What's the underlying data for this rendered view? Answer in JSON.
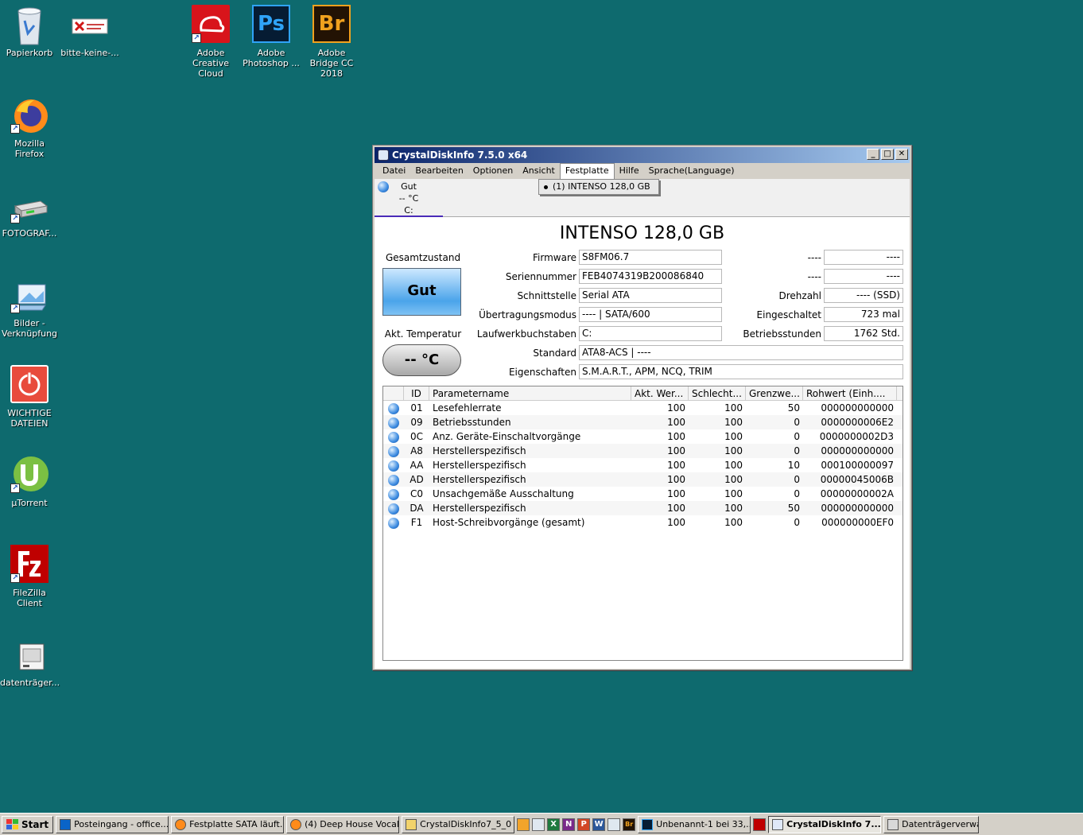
{
  "desktop": {
    "icons": [
      {
        "label": "Papierkorb"
      },
      {
        "label": "bitte-keine-..."
      },
      {
        "label": "Adobe Creative Cloud"
      },
      {
        "label": "Adobe Photoshop ..."
      },
      {
        "label": "Adobe Bridge CC 2018"
      },
      {
        "label": "Mozilla Firefox"
      },
      {
        "label": "FOTOGRAF..."
      },
      {
        "label": "Bilder - Verknüpfung"
      },
      {
        "label": "WICHTIGE DATEIEN"
      },
      {
        "label": "µTorrent"
      },
      {
        "label": "FileZilla Client"
      },
      {
        "label": "datenträger..."
      }
    ],
    "ps_glyph": "Ps",
    "br_glyph": "Br"
  },
  "window": {
    "title": "CrystalDiskInfo 7.5.0 x64",
    "controls": {
      "minimize": "_",
      "maximize": "□",
      "close": "✕"
    },
    "menu": [
      "Datei",
      "Bearbeiten",
      "Optionen",
      "Ansicht",
      "Festplatte",
      "Hilfe",
      "Sprache(Language)"
    ],
    "dropdown_item": "(1) INTENSO 128,0 GB",
    "drive_tab": {
      "status": "Gut",
      "temp": "-- °C",
      "letter": "C:"
    },
    "model": "INTENSO 128,0 GB",
    "health_label": "Gesamtzustand",
    "health_value": "Gut",
    "temp_label": "Akt. Temperatur",
    "temp_value": "-- °C",
    "fields": {
      "firmware": {
        "label": "Firmware",
        "value": "S8FM06.7"
      },
      "serial": {
        "label": "Seriennummer",
        "value": "FEB4074319B200086840"
      },
      "interface": {
        "label": "Schnittstelle",
        "value": "Serial ATA"
      },
      "transfer": {
        "label": "Übertragungsmodus",
        "value": "---- | SATA/600"
      },
      "letters": {
        "label": "Laufwerkbuchstaben",
        "value": "C:"
      },
      "standard": {
        "label": "Standard",
        "value": "ATA8-ACS | ----"
      },
      "features": {
        "label": "Eigenschaften",
        "value": "S.M.A.R.T., APM, NCQ, TRIM"
      },
      "r1": {
        "label": "----",
        "value": "----"
      },
      "r2": {
        "label": "----",
        "value": "----"
      },
      "rpm": {
        "label": "Drehzahl",
        "value": "---- (SSD)"
      },
      "powercount": {
        "label": "Eingeschaltet",
        "value": "723 mal"
      },
      "hours": {
        "label": "Betriebsstunden",
        "value": "1762 Std."
      }
    },
    "smart": {
      "headers": [
        "ID",
        "Parametername",
        "Akt. Wer...",
        "Schlecht...",
        "Grenzwe...",
        "Rohwert (Einh...."
      ],
      "rows": [
        [
          "01",
          "Lesefehlerrate",
          "100",
          "100",
          "50",
          "000000000000"
        ],
        [
          "09",
          "Betriebsstunden",
          "100",
          "100",
          "0",
          "0000000006E2"
        ],
        [
          "0C",
          "Anz. Geräte-Einschaltvorgänge",
          "100",
          "100",
          "0",
          "0000000002D3"
        ],
        [
          "A8",
          "Herstellerspezifisch",
          "100",
          "100",
          "0",
          "000000000000"
        ],
        [
          "AA",
          "Herstellerspezifisch",
          "100",
          "100",
          "10",
          "000100000097"
        ],
        [
          "AD",
          "Herstellerspezifisch",
          "100",
          "100",
          "0",
          "00000045006B"
        ],
        [
          "C0",
          "Unsachgemäße Ausschaltung",
          "100",
          "100",
          "0",
          "00000000002A"
        ],
        [
          "DA",
          "Herstellerspezifisch",
          "100",
          "100",
          "50",
          "000000000000"
        ],
        [
          "F1",
          "Host-Schreibvorgänge (gesamt)",
          "100",
          "100",
          "0",
          "000000000EF0"
        ]
      ]
    }
  },
  "taskbar": {
    "start": "Start",
    "tasks": [
      "Posteingang - office...",
      "Festplatte SATA läuft...",
      "(4) Deep House Vocal...",
      "CrystalDiskInfo7_5_0",
      "Unbenannt-1 bei 33,...",
      "CrystalDiskInfo 7....",
      "Datenträgerverwalt..."
    ],
    "quick_launch": [
      "X",
      "N",
      "P",
      "W",
      "Br"
    ]
  }
}
